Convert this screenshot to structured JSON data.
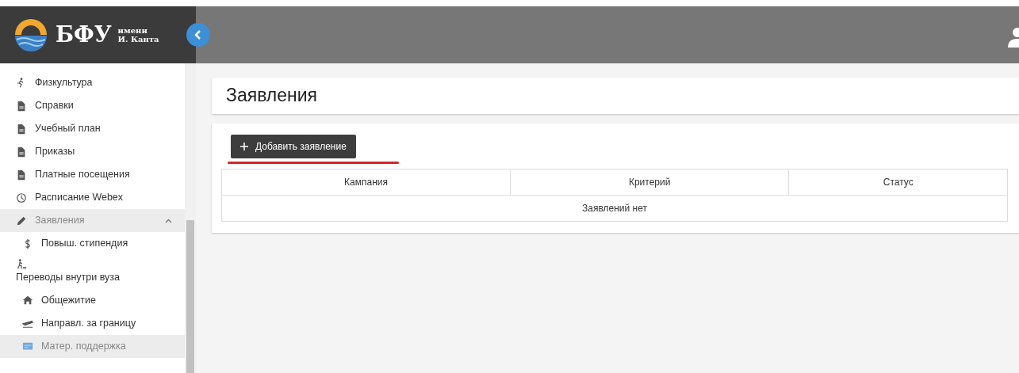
{
  "header": {
    "logo": {
      "name": "БФУ",
      "line_1": "имени",
      "line_2": "И. Канта"
    }
  },
  "sidebar": {
    "items": [
      {
        "label": "Физкультура",
        "selected": false
      },
      {
        "label": "Справки",
        "selected": false
      },
      {
        "label": "Учебный план",
        "selected": false
      },
      {
        "label": "Приказы",
        "selected": false
      },
      {
        "label": "Платные посещения",
        "selected": false
      },
      {
        "label": "Расписание Webex",
        "selected": false
      },
      {
        "label": "Заявления",
        "selected": true,
        "expanded": true,
        "children": [
          {
            "label": "Повыш. стипендия",
            "selected": false
          },
          {
            "label": "Переводы внутри вуза",
            "icon_above": true,
            "selected": false
          },
          {
            "label": "Общежитие",
            "selected": false
          },
          {
            "label": "Направл. за границу",
            "selected": false
          },
          {
            "label": "Матер. поддержка",
            "selected": true
          }
        ]
      }
    ]
  },
  "page": {
    "title": "Заявления",
    "add_button": "Добавить заявление",
    "table": {
      "columns": [
        "Кампания",
        "Критерий",
        "Статус"
      ],
      "empty_message": "Заявлений нет"
    }
  }
}
